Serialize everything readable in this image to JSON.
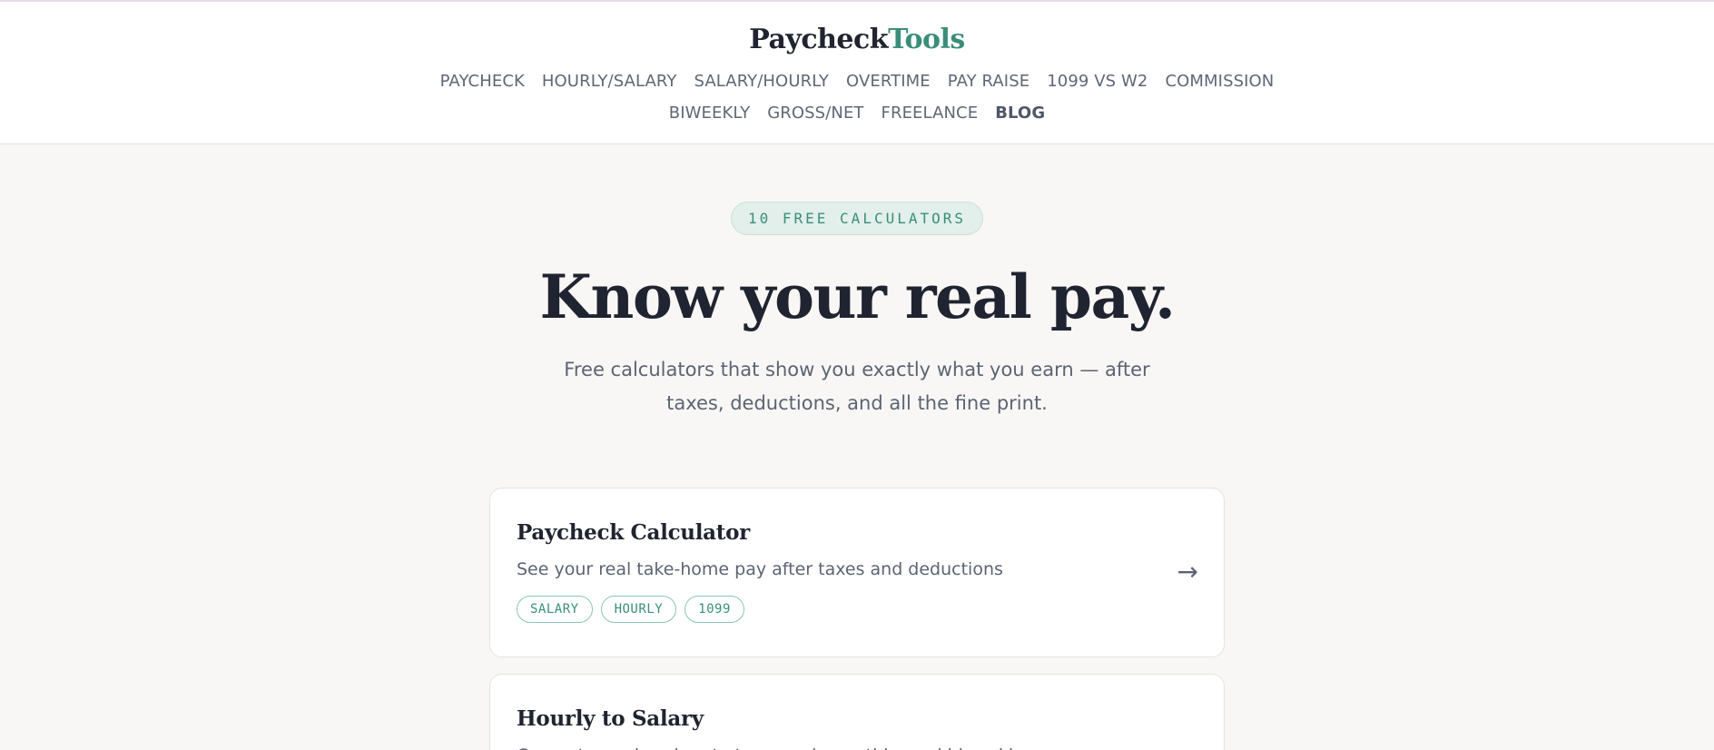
{
  "brand": {
    "part1": "Paycheck",
    "part2": "Tools",
    "accent": "#3a8e79"
  },
  "nav": {
    "row1": [
      "PAYCHECK",
      "HOURLY/SALARY",
      "SALARY/HOURLY",
      "OVERTIME",
      "PAY RAISE",
      "1099 VS W2",
      "COMMISSION"
    ],
    "row2": [
      "BIWEEKLY",
      "GROSS/NET",
      "FREELANCE",
      "BLOG"
    ]
  },
  "hero": {
    "badge": "10 FREE CALCULATORS",
    "title": "Know your real pay.",
    "subtitle": "Free calculators that show you exactly what you earn — after taxes, deductions, and all the fine print."
  },
  "cards": [
    {
      "title": "Paycheck Calculator",
      "description": "See your real take-home pay after taxes and deductions",
      "tags": [
        "SALARY",
        "HOURLY",
        "1099"
      ],
      "arrow": "→"
    },
    {
      "title": "Hourly to Salary",
      "description": "Convert your hourly rate to annual, monthly, and biweekly pay"
    }
  ]
}
